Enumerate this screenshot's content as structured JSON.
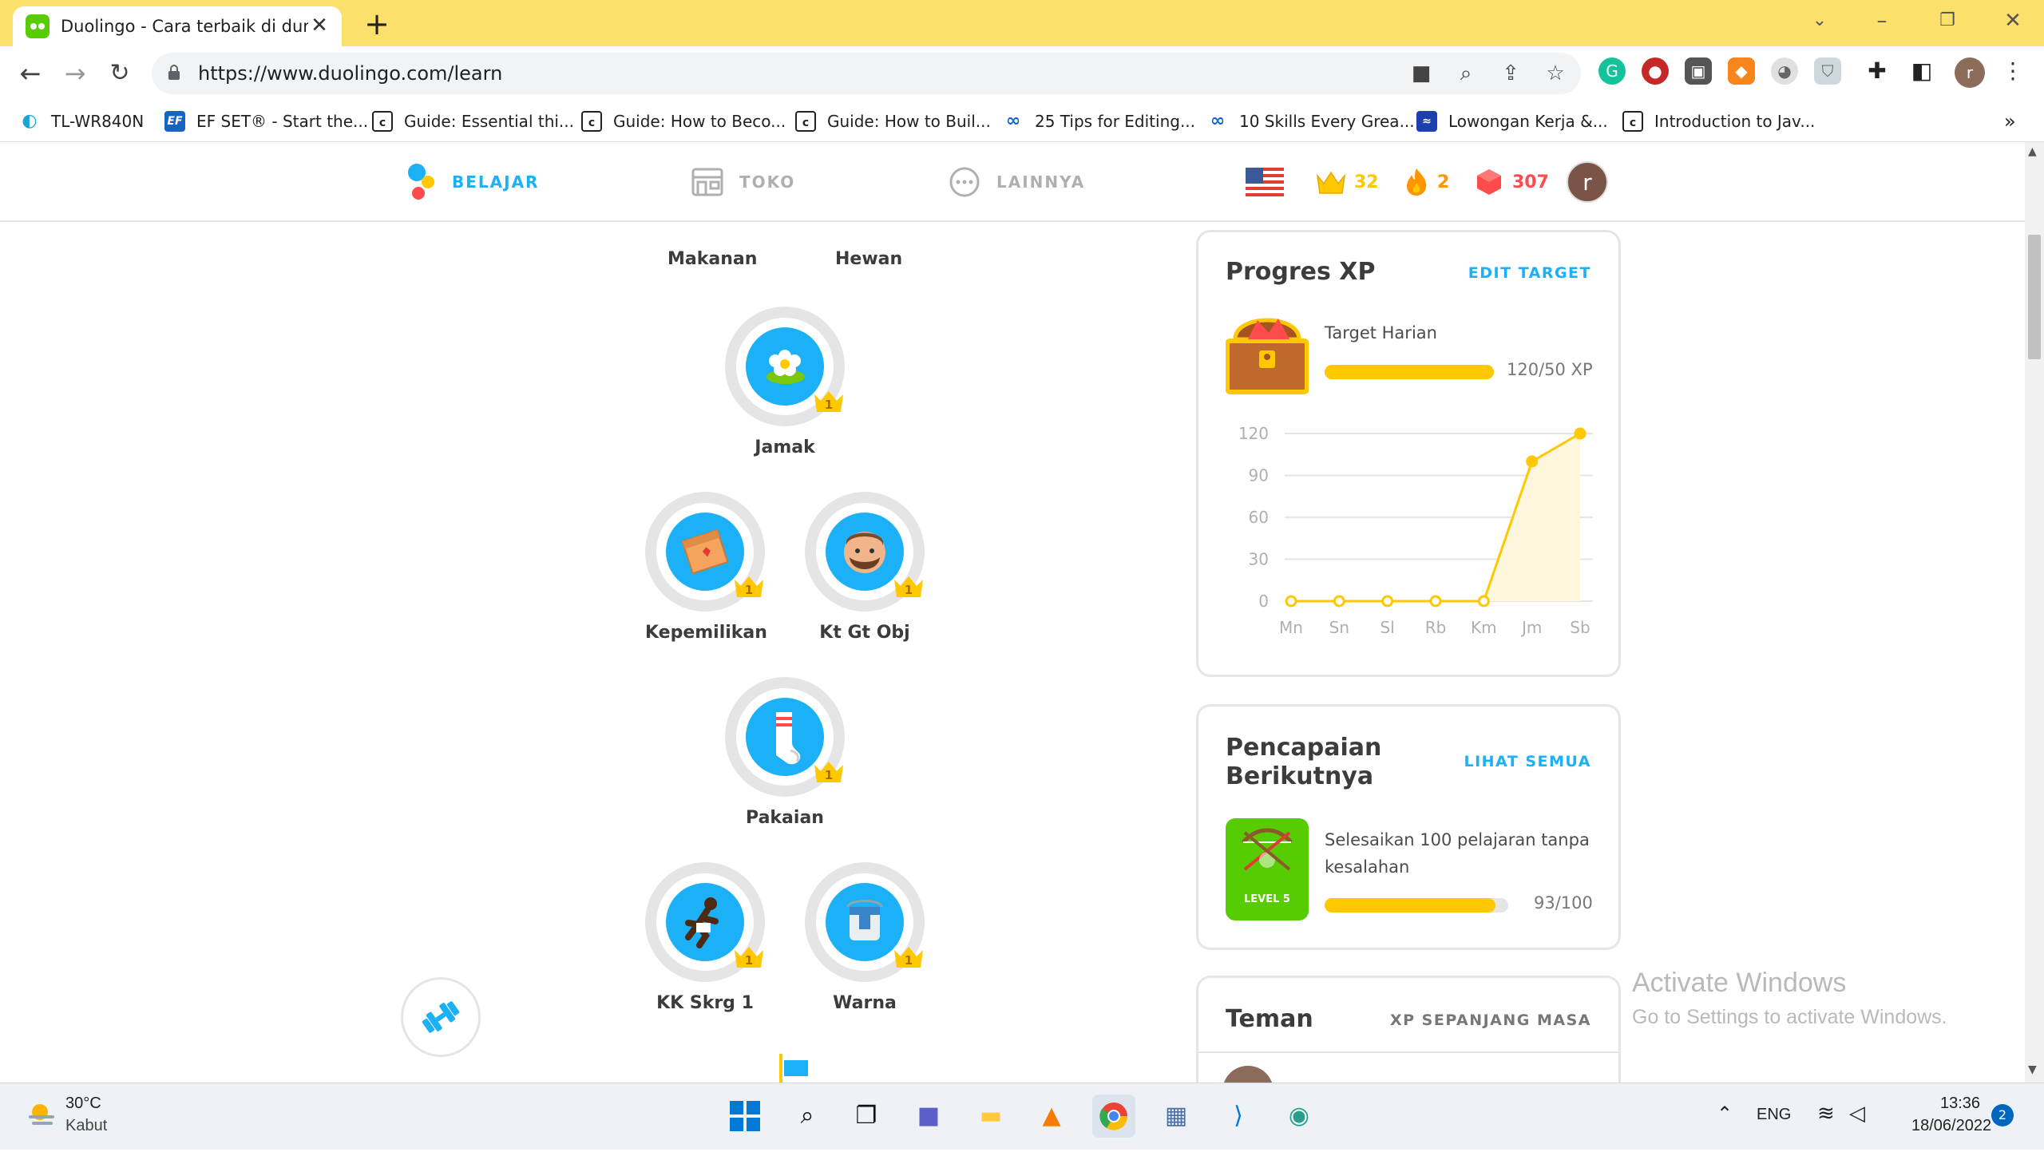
{
  "browser": {
    "tab_title": "Duolingo - Cara terbaik di dunia",
    "url": "https://www.duolingo.com/learn",
    "profile_initial": "r"
  },
  "bookmarks": [
    {
      "label": "TL-WR840N",
      "icon": "tplink-icon"
    },
    {
      "label": "EF SET® - Start the...",
      "icon": "ef-icon"
    },
    {
      "label": "Guide: Essential thi...",
      "icon": "codecademy-icon"
    },
    {
      "label": "Guide: How to Beco...",
      "icon": "codecademy-icon"
    },
    {
      "label": "Guide: How to Buil...",
      "icon": "codecademy-icon"
    },
    {
      "label": "25 Tips for Editing...",
      "icon": "link-icon"
    },
    {
      "label": "10 Skills Every Grea...",
      "icon": "link-icon"
    },
    {
      "label": "Lowongan Kerja &...",
      "icon": "jobstreet-icon"
    },
    {
      "label": "Introduction to Jav...",
      "icon": "codecademy-icon"
    }
  ],
  "bookmarks_more": "»",
  "header": {
    "nav": [
      {
        "label": "BELAJAR",
        "active": true
      },
      {
        "label": "TOKO",
        "active": false
      },
      {
        "label": "LAINNYA",
        "active": false
      }
    ],
    "crowns": "32",
    "streak": "2",
    "gems": "307",
    "avatar_initial": "r"
  },
  "skills": {
    "top_partial": [
      "Makanan",
      "Hewan"
    ],
    "items": [
      {
        "label": "Jamak",
        "crown": "1",
        "icon": "flower-icon"
      },
      {
        "label": "Kepemilikan",
        "crown": "1",
        "icon": "box-icon"
      },
      {
        "label": "Kt Gt Obj",
        "crown": "1",
        "icon": "face-icon"
      },
      {
        "label": "Pakaian",
        "crown": "1",
        "icon": "sock-icon"
      },
      {
        "label": "KK Skrg 1",
        "crown": "1",
        "icon": "runner-icon"
      },
      {
        "label": "Warna",
        "crown": "1",
        "icon": "paint-bucket-icon"
      }
    ]
  },
  "xp_card": {
    "title": "Progres XP",
    "link": "EDIT TARGET",
    "goal_label": "Target Harian",
    "goal_value": "120/50 XP",
    "goal_fraction": 1.0
  },
  "chart_data": {
    "type": "line",
    "categories": [
      "Mn",
      "Sn",
      "Sl",
      "Rb",
      "Km",
      "Jm",
      "Sb"
    ],
    "values": [
      0,
      0,
      0,
      0,
      0,
      100,
      120
    ],
    "yticks": [
      0,
      30,
      60,
      90,
      120
    ],
    "ylim": [
      0,
      120
    ],
    "grid": true,
    "color": "#ffc800"
  },
  "achievement_card": {
    "title_line1": "Pencapaian",
    "title_line2": "Berikutnya",
    "link": "LIHAT SEMUA",
    "desc_line1": "Selesaikan 100 pelajaran tanpa",
    "desc_line2": "kesalahan",
    "badge_label": "LEVEL 5",
    "progress": "93/100",
    "progress_fraction": 0.93
  },
  "friends_card": {
    "title": "Teman",
    "link": "XP SEPANJANG MASA"
  },
  "watermark": {
    "line1": "Activate Windows",
    "line2": "Go to Settings to activate Windows."
  },
  "taskbar": {
    "weather_temp": "30°C",
    "weather_desc": "Kabut",
    "lang": "ENG",
    "time": "13:36",
    "date": "18/06/2022",
    "notifications": "2"
  },
  "colors": {
    "accent_blue": "#1cb0f6",
    "crown_gold": "#ffc800",
    "streak_orange": "#ff9600",
    "gem_red": "#ff4b4b",
    "chrome_yellow": "#fbe16b"
  }
}
